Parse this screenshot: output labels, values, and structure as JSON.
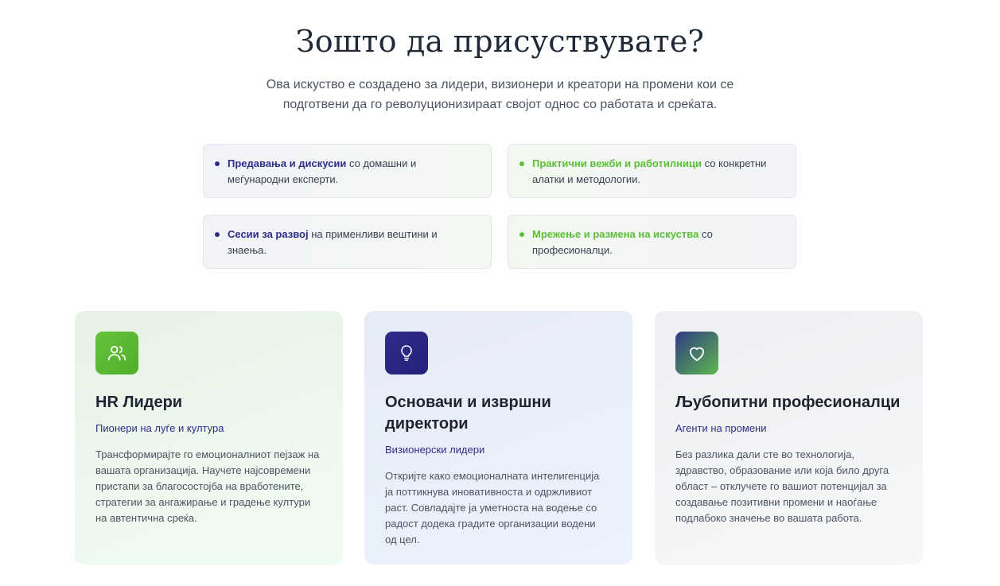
{
  "header": {
    "title": "Зошто да присуствувате?",
    "subtitle": "Ова искуство е создадено за лидери, визионери и креатори на промени кои се подготвени да го револуционизираат својот однос со работата и среќата."
  },
  "benefits": [
    {
      "highlight": "Предавања и дискусии",
      "rest": " со домашни и меѓународни експерти."
    },
    {
      "highlight": "Практични вежби и работилници",
      "rest": " со конкретни алатки и методологии."
    },
    {
      "highlight": "Сесии за развој",
      "rest": " на применливи вештини и знаења."
    },
    {
      "highlight": "Мрежење и размена на искуства",
      "rest": " со професионалци."
    }
  ],
  "audiences": [
    {
      "icon": "users-icon",
      "title": "HR Лидери",
      "subtitle": "Пионери на луѓе и култура",
      "text": "Трансформирајте го емоционалниот пејзаж на вашата организација. Научете најсовремени пристапи за благосостојба на вработените, стратегии за ангажирање и градење култури на автентична среќа."
    },
    {
      "icon": "lightbulb-icon",
      "title": "Основачи и извршни директори",
      "subtitle": "Визионерски лидери",
      "text": "Откријте како емоционалната интелигенција ја поттикнува иновативноста и одржливиот раст. Совладајте ја уметноста на водење со радост додека градите организации водени од цел."
    },
    {
      "icon": "heart-icon",
      "title": "Љубопитни професионалци",
      "subtitle": "Агенти на промени",
      "text": "Без разлика дали сте во технологија, здравство, образование или која било друга област – отклучете го вашиот потенцијал за создавање позитивни промени и наоѓање подлабоко значење во вашата работа."
    }
  ],
  "colors": {
    "primary": "#2e2d8c",
    "accent": "#5bbf36"
  }
}
